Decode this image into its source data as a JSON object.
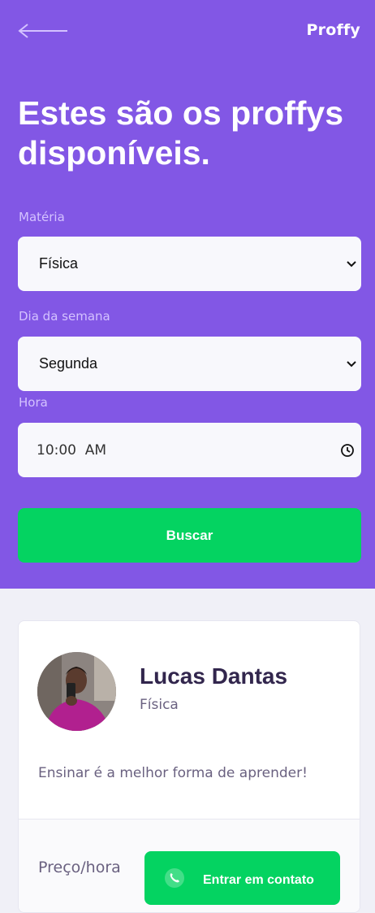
{
  "header": {
    "logo": "Proffy",
    "title": "Estes são os proffys disponíveis."
  },
  "filters": {
    "subject": {
      "label": "Matéria",
      "value": "Física"
    },
    "weekday": {
      "label": "Dia da semana",
      "value": "Segunda"
    },
    "time": {
      "label": "Hora",
      "value": "10:00  AM"
    },
    "submit_label": "Buscar"
  },
  "teacher": {
    "name": "Lucas Dantas",
    "subject": "Física",
    "bio": "Ensinar é a melhor forma de aprender!",
    "price_label": "Preço/hora",
    "contact_label": "Entrar em contato"
  },
  "colors": {
    "primary": "#8257e5",
    "secondary": "#04d361",
    "background": "#f0f0f7",
    "title_text": "#32264d",
    "body_text": "#6a6180"
  },
  "icons": [
    "back-arrow-icon",
    "chevron-down-icon",
    "clock-icon",
    "whatsapp-icon"
  ]
}
